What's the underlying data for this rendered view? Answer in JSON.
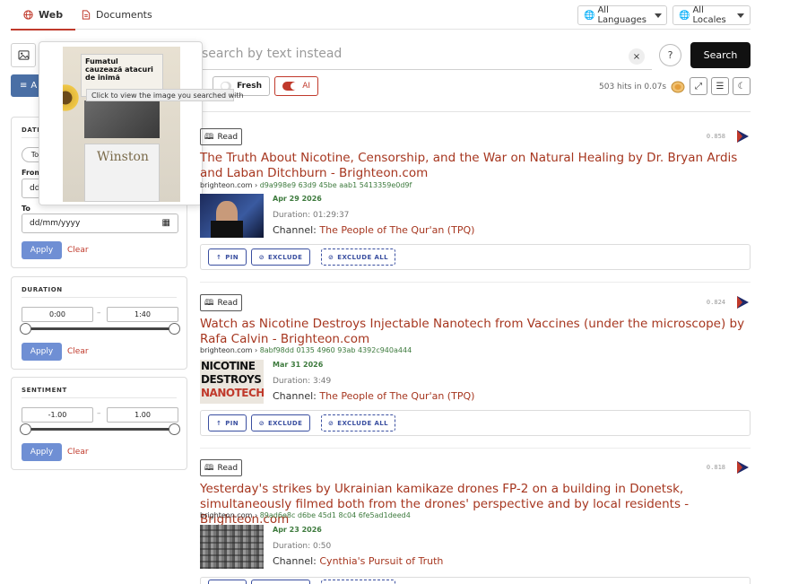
{
  "nav": {
    "tabs": [
      {
        "label": "Web"
      },
      {
        "label": "Documents"
      }
    ],
    "language_select": "All Languages",
    "locale_select": "All Locales"
  },
  "search": {
    "placeholder": "search by text instead",
    "button_label": "Search",
    "clear_symbol": "×",
    "help_symbol": "?"
  },
  "toolbar": {
    "advanced_label": "A",
    "fresh_label": "Fresh",
    "ai_label": "AI",
    "ai_on": true,
    "fresh_on": false,
    "hits_text": "503 hits in 0.07s"
  },
  "popover": {
    "tooltip": "Click to view the image you searched with",
    "photo_text_lines": [
      "Fumatul",
      "cauzează atacuri",
      "de inimă"
    ],
    "brand_text": "Winston"
  },
  "filters": {
    "date": {
      "title": "DATE",
      "today_label": "To",
      "from_label": "From",
      "from_value": "dd",
      "to_label": "To",
      "to_value": "dd/mm/yyyy",
      "apply": "Apply",
      "clear": "Clear"
    },
    "duration": {
      "title": "DURATION",
      "min": "0:00",
      "max": "1:40",
      "apply": "Apply",
      "clear": "Clear"
    },
    "sentiment": {
      "title": "SENTIMENT",
      "min": "-1.00",
      "max": "1.00",
      "apply": "Apply",
      "clear": "Clear"
    },
    "range_dash": "–"
  },
  "results": [
    {
      "read_label": "Read",
      "score": "0.858",
      "title": "The Truth About Nicotine, Censorship, and the War on Natural Healing by Dr. Bryan Ardis and Laban Ditchburn - Brighteon.com",
      "domain": "brighteon.com",
      "hash": "d9a998e9 63d9 45be aab1 5413359e0d9f",
      "date": "Apr 29 2026",
      "duration": "Duration: 01:29:37",
      "channel_prefix": "Channel:",
      "channel": "The People of The Qur'an (TPQ)",
      "pin": "PIN",
      "exclude": "EXCLUDE",
      "exclude_all": "EXCLUDE ALL"
    },
    {
      "read_label": "Read",
      "score": "0.824",
      "title": "Watch as Nicotine Destroys Injectable Nanotech from Vaccines (under the microscope) by Rafa Calvin - Brighteon.com",
      "domain": "brighteon.com",
      "hash": "8abf98dd 0135 4960 93ab 4392c940a444",
      "date": "Mar 31 2026",
      "duration": "Duration: 3:49",
      "channel_prefix": "Channel:",
      "channel": "The People of The Qur'an (TPQ)",
      "thumb_text": [
        "NICOTINE",
        "DESTROYS",
        "NANOTECH"
      ],
      "pin": "PIN",
      "exclude": "EXCLUDE",
      "exclude_all": "EXCLUDE ALL"
    },
    {
      "read_label": "Read",
      "score": "0.818",
      "title": "Yesterday's strikes by Ukrainian kamikaze drones FP-2 on a building in Donetsk, simultaneously filmed both from the drones' perspective and by local residents - Brighteon.com",
      "domain": "brighteon.com",
      "hash": "89ad6e8c d6be 45d1 8c04 6fe5ad1deed4",
      "date": "Apr 23 2026",
      "duration": "Duration: 0:50",
      "channel_prefix": "Channel:",
      "channel": "Cynthia's Pursuit of Truth"
    }
  ],
  "url_separator": "›",
  "colors": {
    "accent": "#c0392b",
    "link": "#a6361f",
    "hash_green": "#3d7a3d",
    "action_blue": "#3a4fa0",
    "apply_blue": "#6f8fd4"
  }
}
